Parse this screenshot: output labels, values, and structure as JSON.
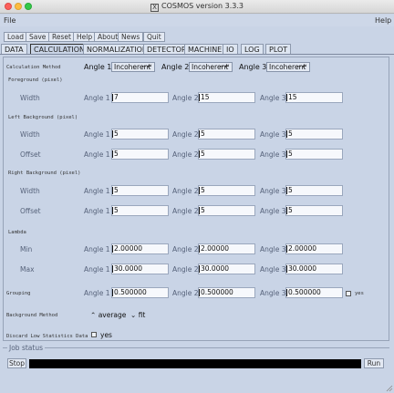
{
  "window": {
    "title": "COSMOS version 3.3.3"
  },
  "menu": {
    "file": "File",
    "help": "Help"
  },
  "toolbar": [
    "Load",
    "Save",
    "Reset",
    "Help",
    "About",
    "News",
    "Quit"
  ],
  "tabs": [
    "DATA",
    "CALCULATION",
    "NORMALIZATION",
    "DETECTOR",
    "MACHINE",
    "IO",
    "LOG",
    "PLOT"
  ],
  "active_tab": "CALCULATION",
  "calculation": {
    "method_label": "Calculation Method",
    "angle_labels": [
      "Angle 1",
      "Angle 2",
      "Angle 3"
    ],
    "methods": [
      "Incoherent",
      "Incoherent",
      "Incoherent"
    ],
    "foreground": {
      "section": "Foreground (pixel)",
      "width_label": "Width",
      "width": [
        "7",
        "15",
        "15"
      ]
    },
    "left_background": {
      "section": "Left Background (pixel)",
      "width_label": "Width",
      "width": [
        "5",
        "5",
        "5"
      ],
      "offset_label": "Offset",
      "offset": [
        "5",
        "5",
        "5"
      ]
    },
    "right_background": {
      "section": "Right Background (pixel)",
      "width_label": "Width",
      "width": [
        "5",
        "5",
        "5"
      ],
      "offset_label": "Offset",
      "offset": [
        "5",
        "5",
        "5"
      ]
    },
    "lambda": {
      "section": "Lambda",
      "min_label": "Min",
      "min": [
        "2.00000",
        "2.00000",
        "2.00000"
      ],
      "max_label": "Max",
      "max": [
        "30.0000",
        "30.0000",
        "30.0000"
      ]
    },
    "grouping": {
      "section": "Grouping",
      "values": [
        "0.500000",
        "0.500000",
        "0.500000"
      ],
      "checkbox_label": "yes"
    },
    "background_method": {
      "section": "Background Method",
      "options": [
        "average",
        "fit"
      ],
      "selected": "fit"
    },
    "discard": {
      "section": "Discard Low Statistics Data",
      "checkbox_label": "yes"
    }
  },
  "job": {
    "label": "Job status",
    "stop": "Stop",
    "run": "Run",
    "progress": 1.0
  }
}
